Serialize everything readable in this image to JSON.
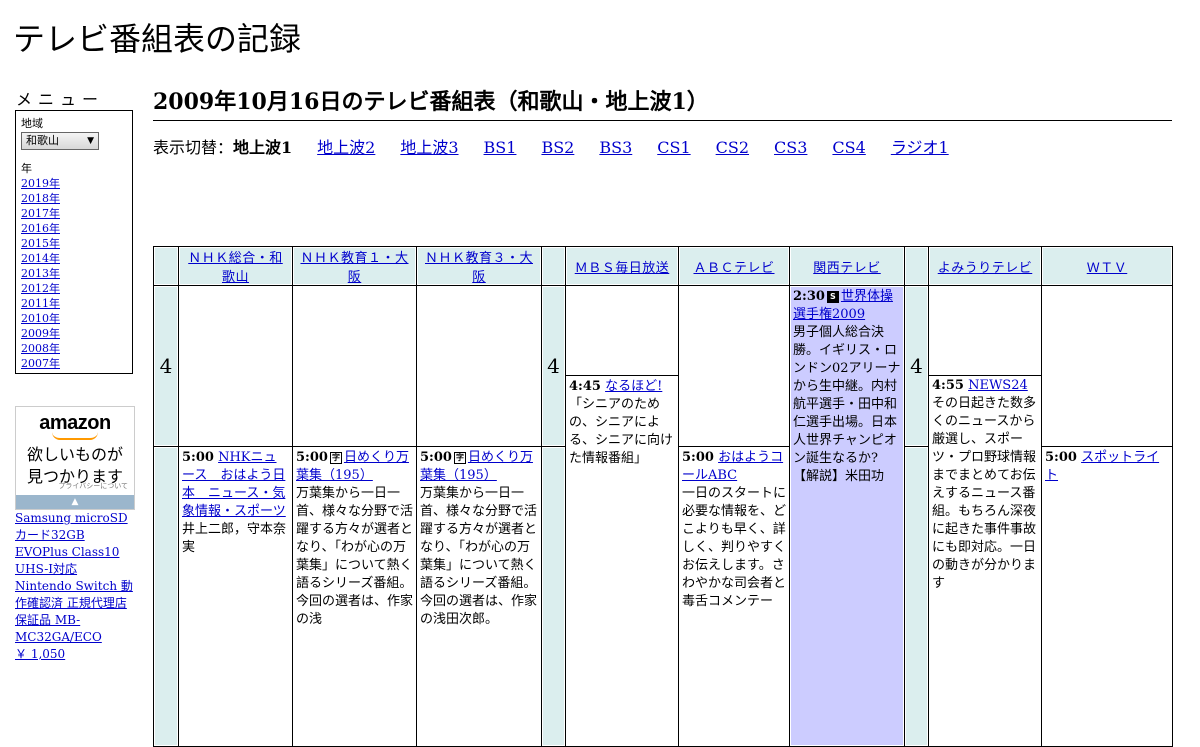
{
  "site_title": "テレビ番組表の記録",
  "menu": {
    "label": "メニュー",
    "region_label": "地域",
    "region_value": "和歌山",
    "year_label": "年",
    "years": [
      "2019年",
      "2018年",
      "2017年",
      "2016年",
      "2015年",
      "2014年",
      "2013年",
      "2012年",
      "2011年",
      "2010年",
      "2009年",
      "2008年",
      "2007年"
    ]
  },
  "ad": {
    "logo": "amazon",
    "text1": "欲しいものが",
    "text2": "見つかります",
    "privacy": "プライバシーについて",
    "product_name": "Samsung microSDカード32GB EVOPlus Class10 UHS-I対応 Nintendo Switch 動作確認済 正規代理店保証品 MB-MC32GA/ECO",
    "product_price": "￥ 1,050"
  },
  "page_title": "2009年10月16日のテレビ番組表（和歌山・地上波1）",
  "switcher": {
    "label": "表示切替：",
    "current": "地上波1",
    "links": [
      "地上波2",
      "地上波3",
      "BS1",
      "BS2",
      "BS3",
      "CS1",
      "CS2",
      "CS3",
      "CS4",
      "ラジオ1"
    ]
  },
  "channels": [
    "ＮＨＫ総合・和歌山",
    "ＮＨＫ教育１・大阪",
    "ＮＨＫ教育３・大阪",
    "ＭＢＳ毎日放送",
    "ＡＢＣテレビ",
    "関西テレビ",
    "よみうりテレビ",
    "ＷＴＶ"
  ],
  "hour": "4",
  "programs": {
    "nhk_sogo": {
      "time": "5:00",
      "title": "NHKニュース　おはよう日本　ニュース・気象情報・スポーツ",
      "desc": "井上二郎，守本奈実"
    },
    "nhk_edu1": {
      "time": "5:00",
      "title": "日めくり万葉集（195）",
      "desc": "万葉集から一日一首、様々な分野で活躍する方々が選者となり、「わが心の万葉集」について熱く語るシリーズ番組。今回の選者は、作家の浅"
    },
    "nhk_edu3": {
      "time": "5:00",
      "title": "日めくり万葉集（195）",
      "desc": "万葉集から一日一首、様々な分野で活躍する方々が選者となり、「わが心の万葉集」について熱く語るシリーズ番組。今回の選者は、作家の浅田次郎。"
    },
    "mbs": {
      "time": "4:45",
      "title": "なるほど!",
      "desc": "「シニアのための、シニアによる、シニアに向けた情報番組」"
    },
    "abc": {
      "time": "5:00",
      "title": "おはようコールABC",
      "desc": "一日のスタートに必要な情報を、どこよりも早く、詳しく、判りやすくお伝えします。さわやかな司会者と毒舌コメンテー"
    },
    "ktv": {
      "time": "2:30",
      "title": "世界体操選手権2009",
      "desc": "男子個人総合決勝。イギリス・ロンドン02アリーナから生中継。内村航平選手・田中和仁選手出場。日本人世界チャンピオン誕生なるか?【解説】米田功"
    },
    "ytv": {
      "time": "4:55",
      "title": "NEWS24",
      "desc": "その日起きた数多くのニュースから厳選し、スポーツ・プロ野球情報までまとめてお伝えするニュース番組。もちろん深夜に起きた事件事故にも即対応。一日の動きが分かります"
    },
    "wtv": {
      "time": "5:00",
      "title": "スポットライト",
      "desc": ""
    }
  },
  "icons": {
    "subtitle_icon": "字",
    "stereo_icon": "S"
  }
}
